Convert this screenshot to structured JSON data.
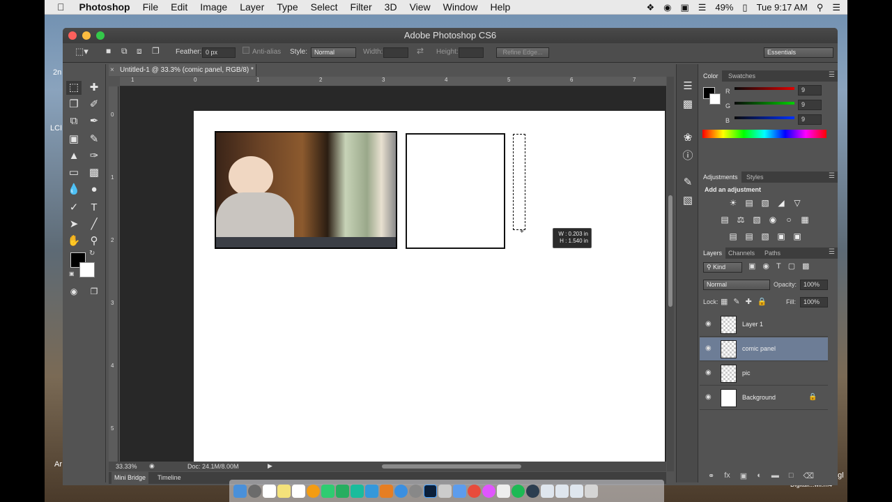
{
  "menubar": {
    "app": "Photoshop",
    "items": [
      "File",
      "Edit",
      "Image",
      "Layer",
      "Type",
      "Select",
      "Filter",
      "3D",
      "View",
      "Window",
      "Help"
    ],
    "battery": "49%",
    "clock": "Tue 9:17 AM"
  },
  "desktop": {
    "labels": [
      "2n",
      "LCI",
      "Ar"
    ],
    "fragments": [
      "ugl",
      "Digitali...wli.m4"
    ]
  },
  "window": {
    "title": "Adobe Photoshop CS6"
  },
  "options": {
    "feather_label": "Feather:",
    "feather_value": "0 px",
    "antialias_label": "Anti-alias",
    "style_label": "Style:",
    "style_value": "Normal",
    "width_label": "Width:",
    "height_label": "Height:",
    "refine_edge": "Refine Edge...",
    "workspace": "Essentials"
  },
  "document": {
    "tab_title": "Untitled-1 @ 33.3% (comic panel, RGB/8) *",
    "ruler_h_labels": [
      "1",
      "0",
      "1",
      "2",
      "3",
      "4",
      "5",
      "6",
      "7"
    ],
    "ruler_v_labels": [
      "0",
      "1",
      "2",
      "3",
      "4",
      "5"
    ],
    "measure_w": "W : 0.203 in",
    "measure_h": "H : 1.540 in"
  },
  "status": {
    "zoom": "33.33%",
    "doc": "Doc: 24.1M/8.00M",
    "tabs": [
      "Mini Bridge",
      "Timeline"
    ]
  },
  "color_panel": {
    "tabs": [
      "Color",
      "Swatches"
    ],
    "r_label": "R",
    "g_label": "G",
    "b_label": "B",
    "r": "9",
    "g": "9",
    "b": "9"
  },
  "adjustments_panel": {
    "tabs": [
      "Adjustments",
      "Styles"
    ],
    "heading": "Add an adjustment"
  },
  "layers_panel": {
    "tabs": [
      "Layers",
      "Channels",
      "Paths"
    ],
    "kind": "Kind",
    "blend_mode": "Normal",
    "opacity_label": "Opacity:",
    "opacity": "100%",
    "lock_label": "Lock:",
    "fill_label": "Fill:",
    "fill": "100%",
    "layers": [
      {
        "name": "Layer 1",
        "selected": false
      },
      {
        "name": "comic panel",
        "selected": true
      },
      {
        "name": "pic",
        "selected": false
      },
      {
        "name": "Background",
        "selected": false
      }
    ]
  },
  "colors": {
    "workspace": "#535353",
    "canvas": "#282828",
    "selection": "#6d7d96",
    "close": "#fc605c",
    "minimize": "#fdbc40",
    "zoom": "#34c84a"
  }
}
